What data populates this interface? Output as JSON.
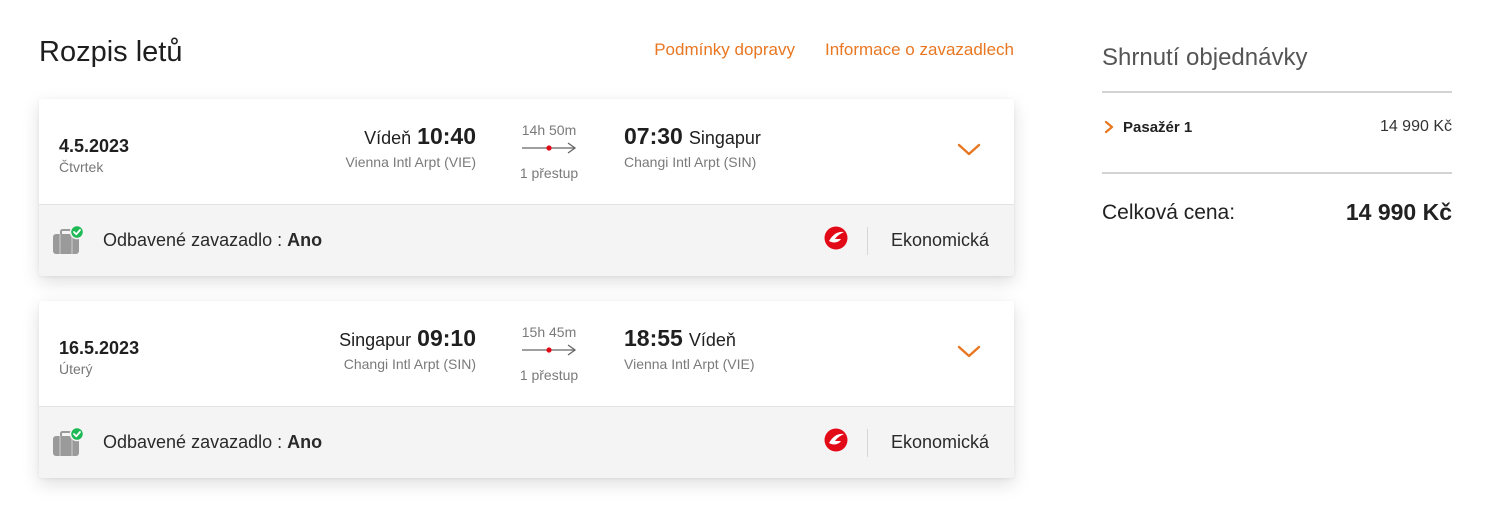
{
  "header": {
    "title": "Rozpis letů",
    "links": [
      "Podmínky dopravy",
      "Informace o zavazadlech"
    ]
  },
  "flights": [
    {
      "date": "4.5.2023",
      "weekday": "Čtvrtek",
      "departure": {
        "city": "Vídeň",
        "time": "10:40",
        "airport": "Vienna Intl Arpt (VIE)"
      },
      "duration": "14h 50m",
      "stops": "1 přestup",
      "arrival": {
        "time": "07:30",
        "city": "Singapur",
        "airport": "Changi Intl Arpt (SIN)"
      },
      "baggage_label": "Odbavené zavazadlo : ",
      "baggage_value": "Ano",
      "cabin": "Ekonomická"
    },
    {
      "date": "16.5.2023",
      "weekday": "Úterý",
      "departure": {
        "city": "Singapur",
        "time": "09:10",
        "airport": "Changi Intl Arpt (SIN)"
      },
      "duration": "15h 45m",
      "stops": "1 přestup",
      "arrival": {
        "time": "18:55",
        "city": "Vídeň",
        "airport": "Vienna Intl Arpt (VIE)"
      },
      "baggage_label": "Odbavené zavazadlo : ",
      "baggage_value": "Ano",
      "cabin": "Ekonomická"
    }
  ],
  "summary": {
    "title": "Shrnutí objednávky",
    "passenger_label": "Pasažér 1",
    "passenger_price": "14 990 Kč",
    "total_label": "Celková cena:",
    "total_price": "14 990 Kč"
  },
  "icons": {
    "chevron": "chevron-down-icon",
    "baggage": "suitcase-check-icon",
    "airline": "turkish-airlines-logo"
  },
  "colors": {
    "accent": "#e87722",
    "check": "#1db954",
    "airline_red": "#e30a17"
  }
}
